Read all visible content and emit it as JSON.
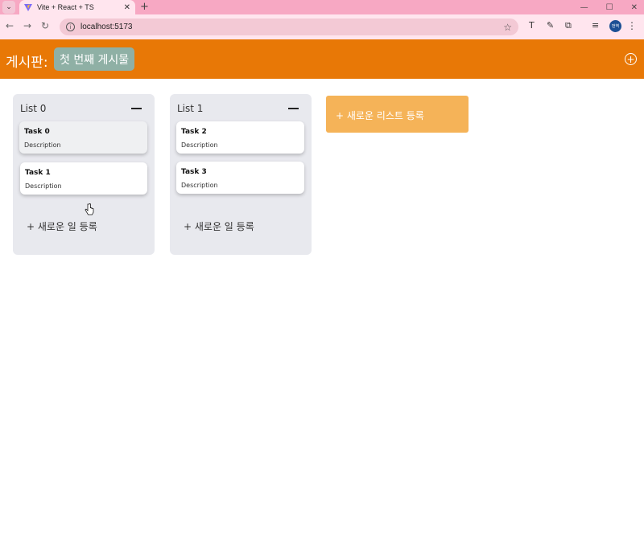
{
  "browser": {
    "tab_title": "Vite + React + TS",
    "url": "localhost:5173",
    "profile_text": "번역"
  },
  "header": {
    "board_label": "게시판:",
    "board_tab": "첫 번째 게시물"
  },
  "lists": [
    {
      "title": "List 0",
      "cards": [
        {
          "title": "Task 0",
          "description": "Description"
        },
        {
          "title": "Task 1",
          "description": "Description"
        }
      ],
      "add_task_label": "+ 새로운 일 등록"
    },
    {
      "title": "List 1",
      "cards": [
        {
          "title": "Task 2",
          "description": "Description"
        },
        {
          "title": "Task 3",
          "description": "Description"
        }
      ],
      "add_task_label": "+ 새로운 일 등록"
    }
  ],
  "add_list_label": "+ 새로운 리스트 등록",
  "colors": {
    "header": "#e87806",
    "board_tab": "#8fb0a5",
    "add_list": "#f5b358",
    "list_bg": "#e8e9ee"
  }
}
